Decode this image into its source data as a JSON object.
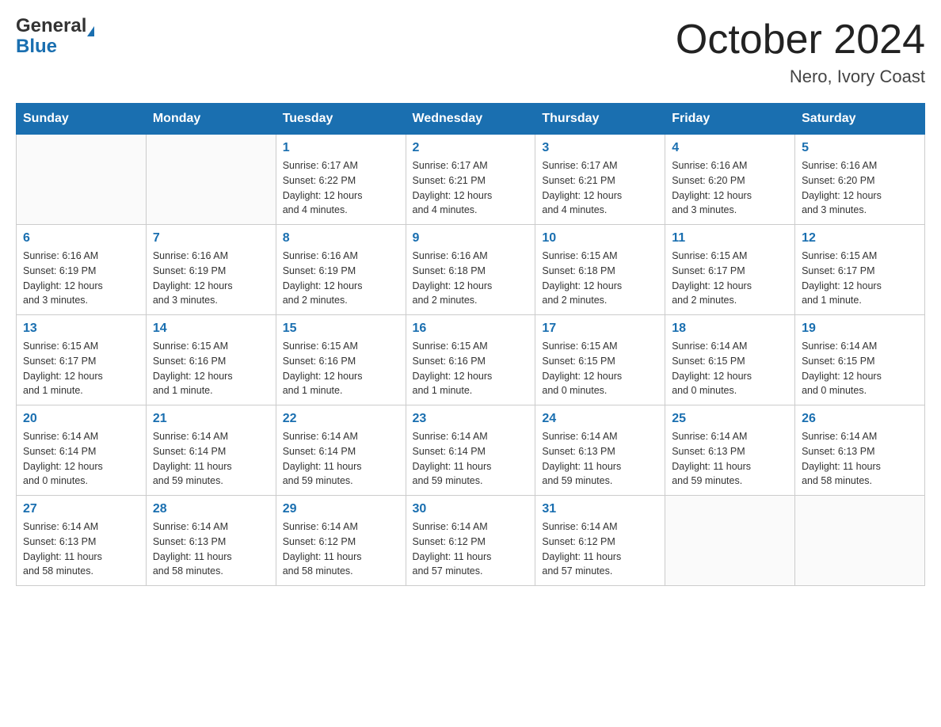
{
  "header": {
    "logo_general": "General",
    "logo_blue": "Blue",
    "title": "October 2024",
    "subtitle": "Nero, Ivory Coast"
  },
  "days_of_week": [
    "Sunday",
    "Monday",
    "Tuesday",
    "Wednesday",
    "Thursday",
    "Friday",
    "Saturday"
  ],
  "weeks": [
    [
      {
        "day": "",
        "info": ""
      },
      {
        "day": "",
        "info": ""
      },
      {
        "day": "1",
        "info": "Sunrise: 6:17 AM\nSunset: 6:22 PM\nDaylight: 12 hours\nand 4 minutes."
      },
      {
        "day": "2",
        "info": "Sunrise: 6:17 AM\nSunset: 6:21 PM\nDaylight: 12 hours\nand 4 minutes."
      },
      {
        "day": "3",
        "info": "Sunrise: 6:17 AM\nSunset: 6:21 PM\nDaylight: 12 hours\nand 4 minutes."
      },
      {
        "day": "4",
        "info": "Sunrise: 6:16 AM\nSunset: 6:20 PM\nDaylight: 12 hours\nand 3 minutes."
      },
      {
        "day": "5",
        "info": "Sunrise: 6:16 AM\nSunset: 6:20 PM\nDaylight: 12 hours\nand 3 minutes."
      }
    ],
    [
      {
        "day": "6",
        "info": "Sunrise: 6:16 AM\nSunset: 6:19 PM\nDaylight: 12 hours\nand 3 minutes."
      },
      {
        "day": "7",
        "info": "Sunrise: 6:16 AM\nSunset: 6:19 PM\nDaylight: 12 hours\nand 3 minutes."
      },
      {
        "day": "8",
        "info": "Sunrise: 6:16 AM\nSunset: 6:19 PM\nDaylight: 12 hours\nand 2 minutes."
      },
      {
        "day": "9",
        "info": "Sunrise: 6:16 AM\nSunset: 6:18 PM\nDaylight: 12 hours\nand 2 minutes."
      },
      {
        "day": "10",
        "info": "Sunrise: 6:15 AM\nSunset: 6:18 PM\nDaylight: 12 hours\nand 2 minutes."
      },
      {
        "day": "11",
        "info": "Sunrise: 6:15 AM\nSunset: 6:17 PM\nDaylight: 12 hours\nand 2 minutes."
      },
      {
        "day": "12",
        "info": "Sunrise: 6:15 AM\nSunset: 6:17 PM\nDaylight: 12 hours\nand 1 minute."
      }
    ],
    [
      {
        "day": "13",
        "info": "Sunrise: 6:15 AM\nSunset: 6:17 PM\nDaylight: 12 hours\nand 1 minute."
      },
      {
        "day": "14",
        "info": "Sunrise: 6:15 AM\nSunset: 6:16 PM\nDaylight: 12 hours\nand 1 minute."
      },
      {
        "day": "15",
        "info": "Sunrise: 6:15 AM\nSunset: 6:16 PM\nDaylight: 12 hours\nand 1 minute."
      },
      {
        "day": "16",
        "info": "Sunrise: 6:15 AM\nSunset: 6:16 PM\nDaylight: 12 hours\nand 1 minute."
      },
      {
        "day": "17",
        "info": "Sunrise: 6:15 AM\nSunset: 6:15 PM\nDaylight: 12 hours\nand 0 minutes."
      },
      {
        "day": "18",
        "info": "Sunrise: 6:14 AM\nSunset: 6:15 PM\nDaylight: 12 hours\nand 0 minutes."
      },
      {
        "day": "19",
        "info": "Sunrise: 6:14 AM\nSunset: 6:15 PM\nDaylight: 12 hours\nand 0 minutes."
      }
    ],
    [
      {
        "day": "20",
        "info": "Sunrise: 6:14 AM\nSunset: 6:14 PM\nDaylight: 12 hours\nand 0 minutes."
      },
      {
        "day": "21",
        "info": "Sunrise: 6:14 AM\nSunset: 6:14 PM\nDaylight: 11 hours\nand 59 minutes."
      },
      {
        "day": "22",
        "info": "Sunrise: 6:14 AM\nSunset: 6:14 PM\nDaylight: 11 hours\nand 59 minutes."
      },
      {
        "day": "23",
        "info": "Sunrise: 6:14 AM\nSunset: 6:14 PM\nDaylight: 11 hours\nand 59 minutes."
      },
      {
        "day": "24",
        "info": "Sunrise: 6:14 AM\nSunset: 6:13 PM\nDaylight: 11 hours\nand 59 minutes."
      },
      {
        "day": "25",
        "info": "Sunrise: 6:14 AM\nSunset: 6:13 PM\nDaylight: 11 hours\nand 59 minutes."
      },
      {
        "day": "26",
        "info": "Sunrise: 6:14 AM\nSunset: 6:13 PM\nDaylight: 11 hours\nand 58 minutes."
      }
    ],
    [
      {
        "day": "27",
        "info": "Sunrise: 6:14 AM\nSunset: 6:13 PM\nDaylight: 11 hours\nand 58 minutes."
      },
      {
        "day": "28",
        "info": "Sunrise: 6:14 AM\nSunset: 6:13 PM\nDaylight: 11 hours\nand 58 minutes."
      },
      {
        "day": "29",
        "info": "Sunrise: 6:14 AM\nSunset: 6:12 PM\nDaylight: 11 hours\nand 58 minutes."
      },
      {
        "day": "30",
        "info": "Sunrise: 6:14 AM\nSunset: 6:12 PM\nDaylight: 11 hours\nand 57 minutes."
      },
      {
        "day": "31",
        "info": "Sunrise: 6:14 AM\nSunset: 6:12 PM\nDaylight: 11 hours\nand 57 minutes."
      },
      {
        "day": "",
        "info": ""
      },
      {
        "day": "",
        "info": ""
      }
    ]
  ]
}
